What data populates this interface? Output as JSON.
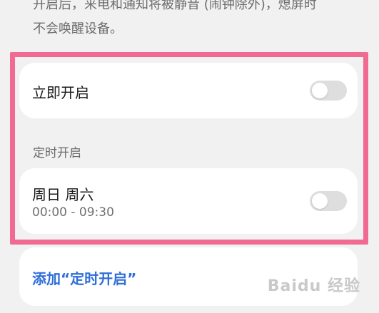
{
  "description": {
    "line1": "开启后，来电和通知将被静音 (闹钟除外)，熄屏时",
    "line2": "不会唤醒设备。"
  },
  "instant": {
    "label": "立即开启",
    "enabled": false
  },
  "schedule_section": {
    "label": "定时开启"
  },
  "schedule_item": {
    "days": "周日 周六",
    "time_range": "00:00 - 09:30",
    "enabled": false
  },
  "add_schedule": {
    "label": "添加“定时开启”"
  },
  "watermark": {
    "text": "Baidu 经验"
  },
  "colors": {
    "highlight": "#f06a92",
    "link": "#2f6ed8",
    "toggle_off": "#dedede"
  }
}
